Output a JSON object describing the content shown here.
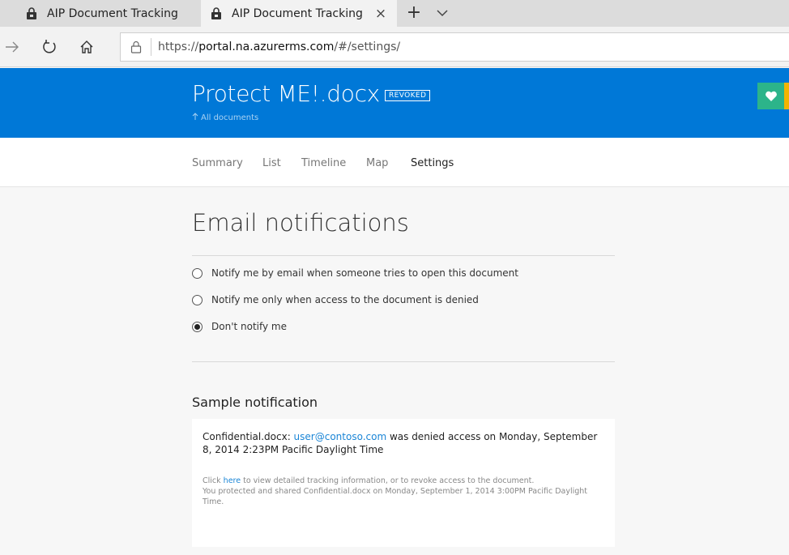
{
  "browser": {
    "tabs": [
      {
        "title": "AIP Document Tracking",
        "active": false
      },
      {
        "title": "AIP Document Tracking",
        "active": true
      }
    ],
    "close_glyph": "×",
    "new_tab_glyph": "+",
    "url_prefix": "https://",
    "url_host": "portal.na.azurerms.com",
    "url_path": "/#/settings/"
  },
  "header": {
    "document_title": "Protect ME!.docx",
    "status_badge": "REVOKED",
    "back_link": "All documents",
    "accent_color": "#0078d7"
  },
  "subnav": {
    "items": [
      {
        "label": "Summary",
        "active": false
      },
      {
        "label": "List",
        "active": false
      },
      {
        "label": "Timeline",
        "active": false
      },
      {
        "label": "Map",
        "active": false
      },
      {
        "label": "Settings",
        "active": true
      }
    ]
  },
  "settings": {
    "section_title": "Email notifications",
    "options": [
      {
        "label": "Notify me by email when someone tries to open this document",
        "checked": false
      },
      {
        "label": "Notify me only when access to the document is denied",
        "checked": false
      },
      {
        "label": "Don't notify me",
        "checked": true
      }
    ]
  },
  "sample": {
    "title": "Sample notification",
    "main_prefix": "Confidential.docx: ",
    "main_email": "user@contoso.com",
    "main_suffix": " was denied access on Monday, September 8, 2014 2:23PM Pacific Daylight Time",
    "foot_prefix": "Click ",
    "foot_link": "here",
    "foot_suffix": " to view detailed tracking information, or to revoke access to the document.",
    "foot_line2": "You protected and shared Confidential.docx on Monday, September 1, 2014 3:00PM Pacific Daylight Time."
  }
}
